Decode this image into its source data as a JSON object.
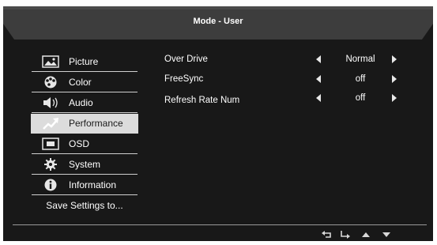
{
  "header": {
    "title": "Mode - User"
  },
  "menu": {
    "items": [
      {
        "label": "Picture",
        "icon": "picture-icon"
      },
      {
        "label": "Color",
        "icon": "palette-icon"
      },
      {
        "label": "Audio",
        "icon": "speaker-icon"
      },
      {
        "label": "Performance",
        "icon": "trend-arrow-icon"
      },
      {
        "label": "OSD",
        "icon": "osd-icon"
      },
      {
        "label": "System",
        "icon": "gear-icon"
      },
      {
        "label": "Information",
        "icon": "info-icon"
      },
      {
        "label": "Save Settings to..."
      }
    ],
    "selected": "Performance"
  },
  "settings": [
    {
      "label": "Over Drive",
      "value": "Normal"
    },
    {
      "label": "FreeSync",
      "value": "off"
    },
    {
      "label": "Refresh Rate Num",
      "value": "off"
    }
  ],
  "footer": {
    "nav_icons": [
      "back-icon",
      "enter-icon",
      "up-triangle-icon",
      "down-triangle-icon"
    ]
  },
  "colors": {
    "background": "#181818",
    "header": "#3a3a3a",
    "selected_item": "#dcdcdc",
    "text": "#ffffff"
  }
}
